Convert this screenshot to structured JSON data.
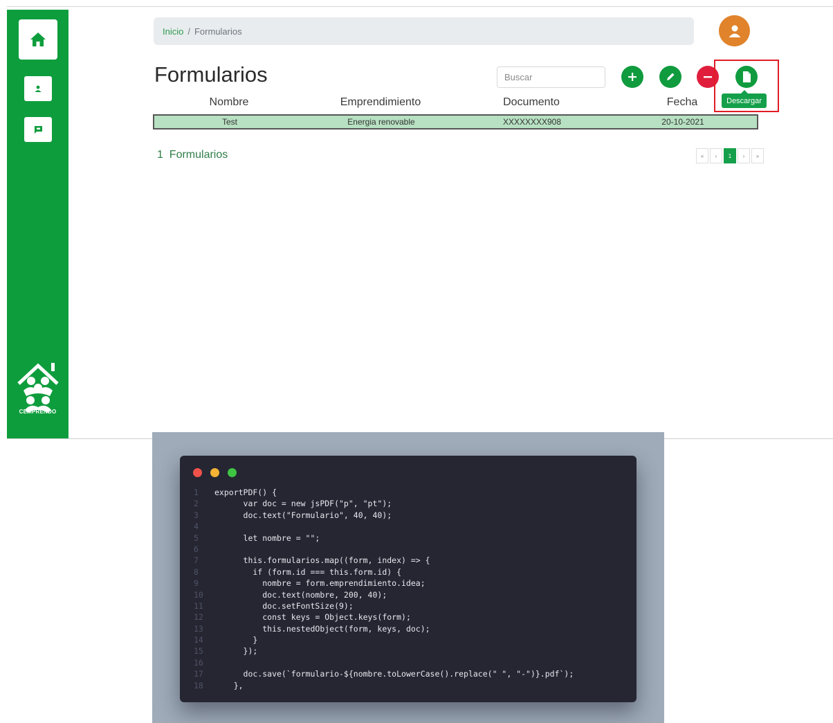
{
  "breadcrumb": {
    "home": "Inicio",
    "separator": "/",
    "current": "Formularios"
  },
  "page": {
    "title": "Formularios"
  },
  "search": {
    "placeholder": "Buscar"
  },
  "actions": {
    "download_tooltip": "Descargar"
  },
  "table": {
    "headers": [
      "Nombre",
      "Emprendimiento",
      "Documento",
      "Fecha"
    ],
    "rows": [
      [
        "Test",
        "Energia renovable",
        "XXXXXXXX908",
        "20-10-2021"
      ]
    ]
  },
  "footer": {
    "count_number": "1",
    "count_label": "Formularios"
  },
  "pagination": {
    "first": "«",
    "prev": "‹",
    "current": "1",
    "next": "›",
    "last": "»"
  },
  "brand": {
    "logo_text": "CEMPRENDO"
  },
  "icons": {
    "home": "home-icon",
    "profile": "person-card-icon",
    "messages": "chat-icon",
    "avatar": "user-icon",
    "add": "plus-icon",
    "edit": "pencil-icon",
    "delete": "minus-icon",
    "download": "file-icon"
  },
  "colors": {
    "sidebar": "#0e9d3d",
    "accent": "#109b3e",
    "danger": "#e01e3c",
    "avatar": "#e0832a",
    "row_highlight": "#b7e1c2"
  },
  "code": {
    "lines": [
      {
        "n": "1",
        "t": "exportPDF() {"
      },
      {
        "n": "2",
        "t": "      var doc = new jsPDF(\"p\", \"pt\");"
      },
      {
        "n": "3",
        "t": "      doc.text(\"Formulario\", 40, 40);"
      },
      {
        "n": "4",
        "t": ""
      },
      {
        "n": "5",
        "t": "      let nombre = \"\";"
      },
      {
        "n": "6",
        "t": ""
      },
      {
        "n": "7",
        "t": "      this.formularios.map((form, index) => {"
      },
      {
        "n": "8",
        "t": "        if (form.id === this.form.id) {"
      },
      {
        "n": "9",
        "t": "          nombre = form.emprendimiento.idea;"
      },
      {
        "n": "10",
        "t": "          doc.text(nombre, 200, 40);"
      },
      {
        "n": "11",
        "t": "          doc.setFontSize(9);"
      },
      {
        "n": "12",
        "t": "          const keys = Object.keys(form);"
      },
      {
        "n": "13",
        "t": "          this.nestedObject(form, keys, doc);"
      },
      {
        "n": "14",
        "t": "        }"
      },
      {
        "n": "15",
        "t": "      });"
      },
      {
        "n": "16",
        "t": ""
      },
      {
        "n": "17",
        "t": "      doc.save(`formulario-${nombre.toLowerCase().replace(\" \", \"-\")}.pdf`);"
      },
      {
        "n": "18",
        "t": "    },"
      }
    ]
  }
}
